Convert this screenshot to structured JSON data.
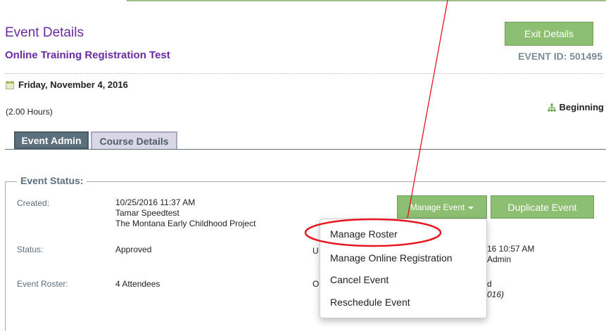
{
  "header": {
    "page_title": "Event Details",
    "event_name": "Online Training Registration Test",
    "exit_label": "Exit Details",
    "event_id": "EVENT ID: 501495"
  },
  "info": {
    "date": "Friday, November 4, 2016",
    "hours": "(2.00 Hours)",
    "level": "Beginning"
  },
  "tabs": [
    {
      "label": "Event Admin",
      "active": true
    },
    {
      "label": "Course Details",
      "active": false
    }
  ],
  "status_section": {
    "legend": "Event Status:",
    "created_label": "Created:",
    "created_datetime": "10/25/2016 11:37 AM",
    "created_by": "Tamar Speedtest",
    "created_org": "The Montana Early Childhood Project",
    "status_label": "Status:",
    "status_value": "Approved",
    "roster_label": "Event Roster:",
    "roster_value": "4 Attendees",
    "right_letter_1": "U",
    "right_value_1": "16 10:57 AM",
    "right_value_1b": "Admin",
    "right_letter_2": "O",
    "right_value_2": "d",
    "right_value_2b": "016)"
  },
  "buttons": {
    "manage_event": "Manage Event",
    "duplicate_event": "Duplicate Event"
  },
  "dropdown": {
    "items": [
      "Manage Roster",
      "Manage Online Registration",
      "Cancel Event",
      "Reschedule Event"
    ]
  },
  "icons": {
    "date": "calendar-icon",
    "level": "level-hierarchy-icon",
    "manage_caret": "caret-down-icon"
  },
  "colors": {
    "purple_title": "#6a2aa0",
    "green_button": "#8cbf72",
    "tab_active": "#5c6f7d",
    "annotation_red": "#e8141e"
  }
}
